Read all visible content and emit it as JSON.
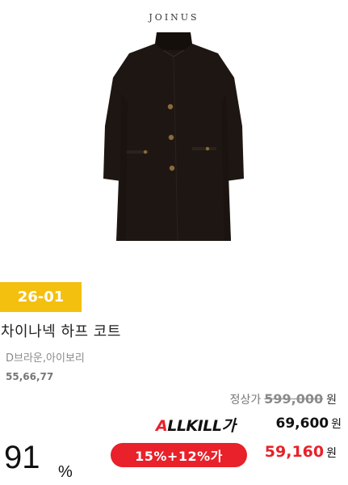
{
  "product": {
    "brand": "JOINUS",
    "code_badge": "26-01",
    "name": "차이나넥 하프 코트",
    "colors": "D브라운,아이보리",
    "sizes": "55,66,77"
  },
  "pricing": {
    "regular_label": "정상가",
    "regular_price": "599,000",
    "currency": "원",
    "allkill_logo_first": "A",
    "allkill_logo_rest": "LLKILL가",
    "allkill_price": "69,600",
    "discount_label": "15%+12%가",
    "final_price": "59,160",
    "rate": "91",
    "rate_unit": "%"
  },
  "colors": {
    "badge": "#f4c00f",
    "accent_red": "#e8212a",
    "coat": "#1e1612"
  },
  "icons": {
    "product_photo": "coat-image"
  }
}
